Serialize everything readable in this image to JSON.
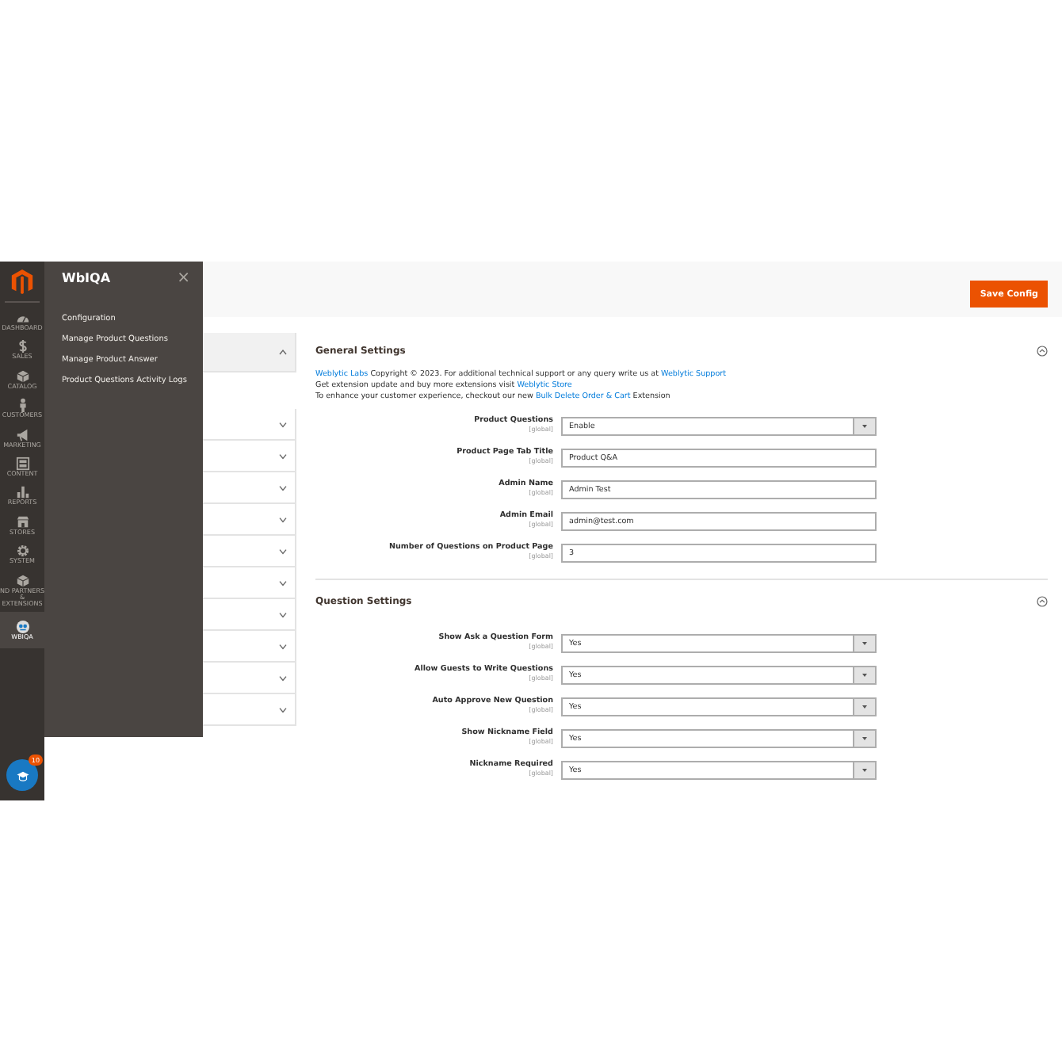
{
  "nav": {
    "items": [
      {
        "label": "DASHBOARD",
        "selected": false
      },
      {
        "label": "SALES",
        "selected": false
      },
      {
        "label": "CATALOG",
        "selected": false
      },
      {
        "label": "CUSTOMERS",
        "selected": false
      },
      {
        "label": "MARKETING",
        "selected": false
      },
      {
        "label": "CONTENT",
        "selected": false
      },
      {
        "label": "REPORTS",
        "selected": false
      },
      {
        "label": "STORES",
        "selected": false
      },
      {
        "label": "SYSTEM",
        "selected": false
      },
      {
        "label": "ND PARTNERS & EXTENSIONS",
        "selected": false
      },
      {
        "label": "WBIQA",
        "selected": true
      }
    ],
    "badge": "10"
  },
  "flyout": {
    "title": "WbIQA",
    "close": "×",
    "items": [
      "Configuration",
      "Manage Product Questions",
      "Manage Product Answer",
      "Product Questions Activity Logs"
    ]
  },
  "header": {
    "button": "Save Config"
  },
  "config_tabs": [
    {
      "expanded": true
    },
    {
      "expanded": false
    },
    {
      "expanded": false
    },
    {
      "expanded": false
    },
    {
      "expanded": false
    },
    {
      "expanded": false
    },
    {
      "expanded": false
    },
    {
      "expanded": false
    },
    {
      "expanded": false
    },
    {
      "expanded": false
    },
    {
      "expanded": false
    }
  ],
  "sections": [
    {
      "title": "General Settings",
      "expanded": true,
      "info": [
        [
          {
            "text": "Weblytic Labs",
            "kind": "link"
          },
          {
            "text": " Copyright © 2023. For additional technical support or any query write us at ",
            "kind": "text"
          },
          {
            "text": "Weblytic Support",
            "kind": "link"
          }
        ],
        [
          {
            "text": "Get extension update and buy more extensions visit ",
            "kind": "text"
          },
          {
            "text": "Weblytic Store",
            "kind": "link"
          }
        ],
        [
          {
            "text": "To enhance your customer experience, checkout our new ",
            "kind": "text"
          },
          {
            "text": "Bulk Delete Order & Cart",
            "kind": "link"
          },
          {
            "text": " Extension",
            "kind": "text"
          }
        ]
      ],
      "fields": [
        {
          "label": "Product Questions",
          "scope": "[global]",
          "kind": "select",
          "value": "Enable"
        },
        {
          "label": "Product Page Tab Title",
          "scope": "[global]",
          "kind": "text",
          "value": "Product Q&A"
        },
        {
          "label": "Admin Name",
          "scope": "[global]",
          "kind": "text",
          "value": "Admin Test"
        },
        {
          "label": "Admin Email",
          "scope": "[global]",
          "kind": "text",
          "value": "admin@test.com"
        },
        {
          "label": "Number of Questions on Product Page",
          "scope": "[global]",
          "kind": "text",
          "value": "3"
        }
      ]
    },
    {
      "title": "Question Settings",
      "expanded": true,
      "fields": [
        {
          "label": "Show Ask a Question Form",
          "scope": "[global]",
          "kind": "select",
          "value": "Yes"
        },
        {
          "label": "Allow Guests to Write Questions",
          "scope": "[global]",
          "kind": "select",
          "value": "Yes"
        },
        {
          "label": "Auto Approve New Question",
          "scope": "[global]",
          "kind": "select",
          "value": "Yes"
        },
        {
          "label": "Show Nickname Field",
          "scope": "[global]",
          "kind": "select",
          "value": "Yes"
        },
        {
          "label": "Nickname Required",
          "scope": "[global]",
          "kind": "select",
          "value": "Yes"
        }
      ]
    }
  ]
}
